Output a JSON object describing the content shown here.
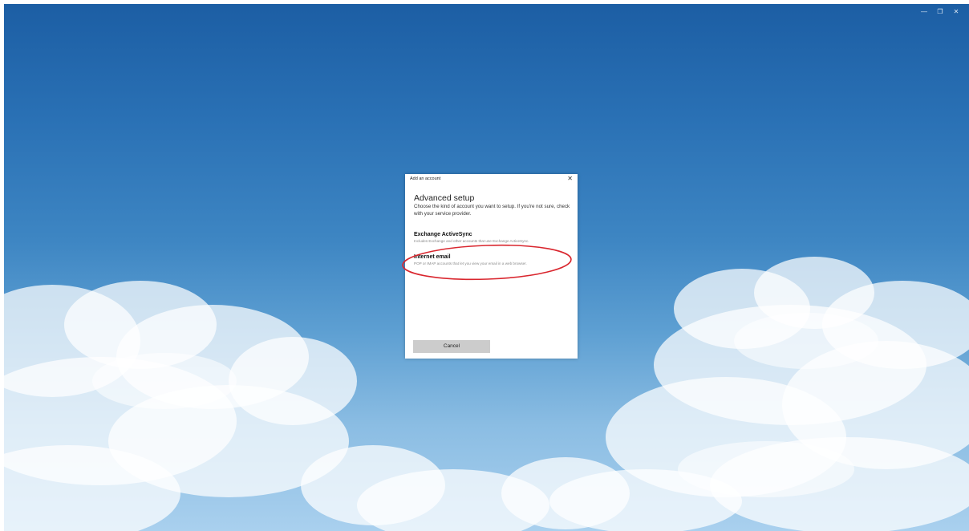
{
  "window_controls": {
    "minimize_glyph": "—",
    "restore_glyph": "❐",
    "close_glyph": "✕"
  },
  "dialog": {
    "title": "Add an account",
    "close_glyph": "✕",
    "heading": "Advanced setup",
    "description": "Choose the kind of account you want to setup. If you're not sure, check with your service provider.",
    "options": [
      {
        "title": "Exchange ActiveSync",
        "subtitle": "Includes Exchange and other accounts that use Exchange ActiveSync."
      },
      {
        "title": "Internet email",
        "subtitle": "POP or IMAP accounts that let you view your email in a web browser."
      }
    ],
    "cancel_label": "Cancel"
  },
  "colors": {
    "annotation": "#d9262e",
    "sky_top": "#1c5ea4",
    "sky_bottom": "#a9d0ee",
    "cancel_bg": "#cccccc"
  },
  "icons": [
    "minimize-icon",
    "restore-icon",
    "close-icon"
  ]
}
